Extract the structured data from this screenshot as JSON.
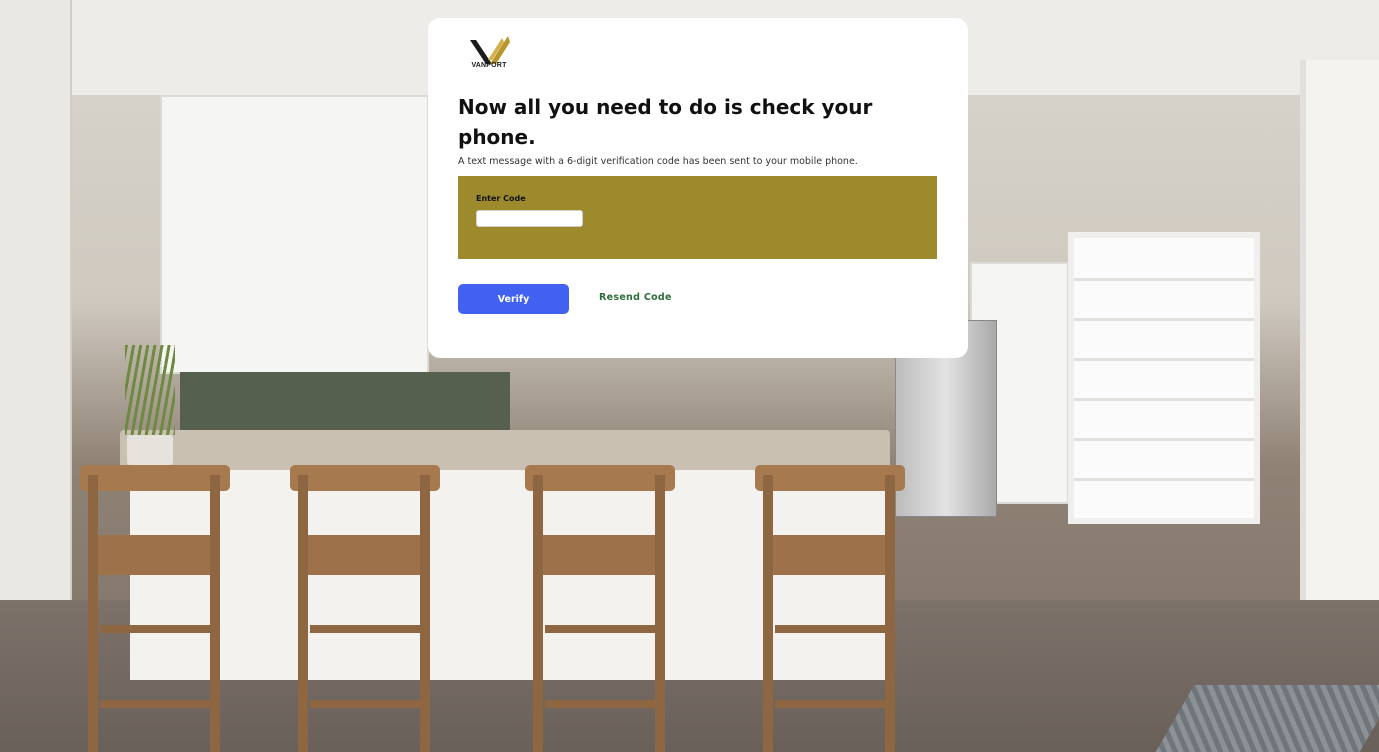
{
  "brand": {
    "name": "VANPORT",
    "logo_icon": "vanport-wings-logo",
    "accent_color": "#9c8a2c"
  },
  "card": {
    "headline": "Now all you need to do is check your phone.",
    "subtext": "A text message with a 6-digit verification code has been sent to your mobile phone."
  },
  "code_entry": {
    "label": "Enter Code",
    "value": "",
    "placeholder": ""
  },
  "actions": {
    "verify_label": "Verify",
    "verify_color": "#4162f1",
    "resend_label": "Resend Code",
    "resend_color": "#2f6d3a"
  }
}
